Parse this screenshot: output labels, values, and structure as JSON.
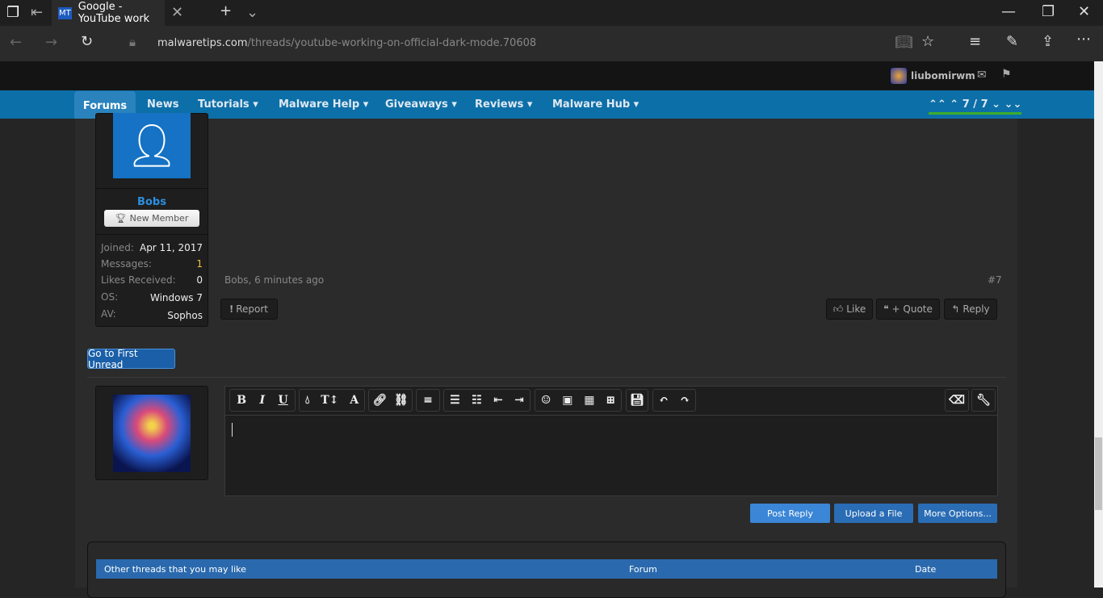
{
  "browser": {
    "tab_title": "Google - YouTube work",
    "favicon": "MT",
    "url_domain": "malwaretips.com",
    "url_path": "/threads/youtube-working-on-official-dark-mode.70608"
  },
  "topbar": {
    "username": "liubomirwm"
  },
  "nav": {
    "items": [
      "Forums",
      "News",
      "Tutorials",
      "Malware Help",
      "Giveaways",
      "Reviews",
      "Malware Hub"
    ],
    "pager": "7 / 7"
  },
  "post": {
    "author": "Bobs",
    "title": "New Member",
    "stats": [
      {
        "label": "Joined:",
        "value": "Apr 11, 2017"
      },
      {
        "label": "Messages:",
        "value": "1"
      },
      {
        "label": "Likes Received:",
        "value": "0"
      },
      {
        "label": "OS:",
        "value": "Windows 7"
      },
      {
        "label": "AV:",
        "value": "Sophos"
      }
    ],
    "meta": "Bobs, 6 minutes ago",
    "number": "#7",
    "report": "Report",
    "like": "Like",
    "quote": "+ Quote",
    "reply": "Reply"
  },
  "first_unread": "Go to First Unread",
  "editor": {
    "toolbar": [
      "B",
      "I",
      "U"
    ],
    "post_reply": "Post Reply",
    "upload": "Upload a File",
    "more": "More Options..."
  },
  "similar": {
    "headers": [
      "Other threads that you may like",
      "Forum",
      "Date"
    ]
  }
}
